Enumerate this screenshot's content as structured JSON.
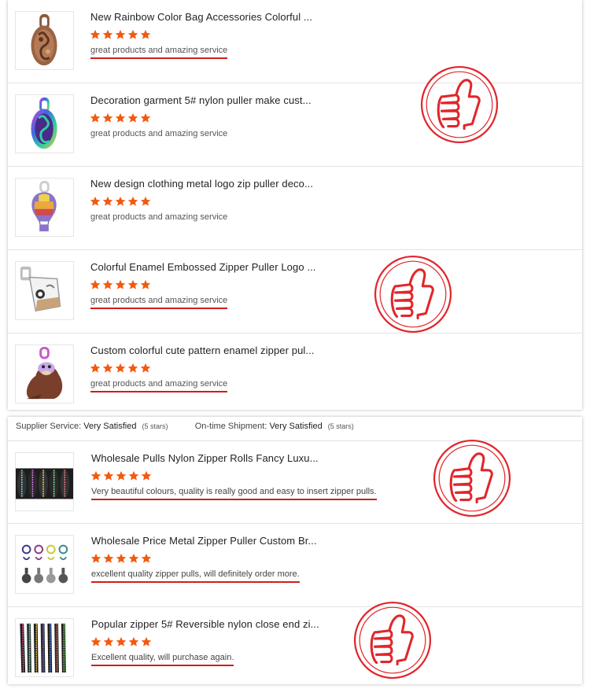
{
  "colors": {
    "star": "#f25a0f",
    "underline": "#d21c1c",
    "stamp": "#e1262b"
  },
  "section1": {
    "products": [
      {
        "title": "New Rainbow Color Bag Accessories Colorful ...",
        "rating": 5,
        "review": "great products and amazing service",
        "image": "bronze-oval-zipper-puller"
      },
      {
        "title": "Decoration garment 5# nylon puller make cust...",
        "rating": 5,
        "review": "great products and amazing service",
        "image": "rainbow-oval-zipper-puller"
      },
      {
        "title": "New design clothing metal logo zip puller deco...",
        "rating": 5,
        "review": "great products and amazing service",
        "image": "hot-air-balloon-zipper-puller"
      },
      {
        "title": "Colorful Enamel Embossed Zipper Puller Logo ...",
        "rating": 5,
        "review": "great products and amazing service",
        "image": "enamel-tag-zipper-puller"
      },
      {
        "title": "Custom colorful cute pattern enamel zipper pul...",
        "rating": 5,
        "review": "great products and amazing service",
        "image": "walrus-zipper-puller"
      }
    ]
  },
  "section2": {
    "summary": {
      "supplier_label": "Supplier Service:",
      "supplier_value": "Very Satisfied",
      "supplier_stars": "(5 stars)",
      "shipment_label": "On-time Shipment:",
      "shipment_value": "Very Satisfied",
      "shipment_stars": "(5 stars)"
    },
    "products": [
      {
        "title": "Wholesale Pulls Nylon Zipper Rolls Fancy Luxu...",
        "rating": 5,
        "review": "Very beautiful colours,  quality is really good and easy to insert zipper pulls.",
        "image": "nylon-zipper-rolls"
      },
      {
        "title": "Wholesale Price Metal Zipper Puller Custom Br...",
        "rating": 5,
        "review": "excellent quality zipper pulls,  will definitely order more.",
        "image": "metal-zipper-pullers-assortment"
      },
      {
        "title": "Popular zipper 5# Reversible nylon close end zi...",
        "rating": 5,
        "review": "Excellent quality, will purchase again.",
        "image": "reversible-nylon-zippers"
      }
    ]
  },
  "icons": {
    "star": "star-icon",
    "stamp": "thumbs-up-stamp-icon"
  }
}
